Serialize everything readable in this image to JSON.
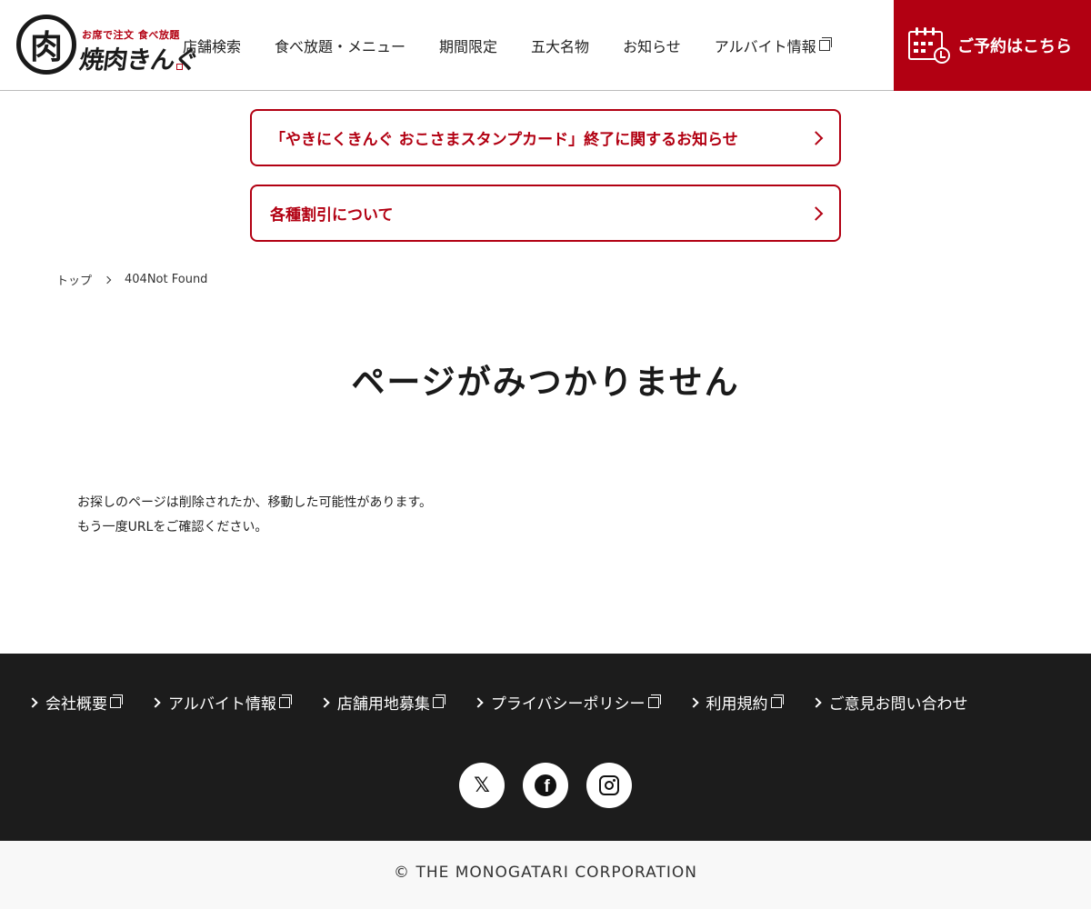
{
  "header": {
    "logo": {
      "mark": "肉",
      "tagline": "お席で注文 食べ放題",
      "name": "焼肉きんぐ"
    },
    "nav": [
      {
        "label": "店舗検索",
        "external": false
      },
      {
        "label": "食べ放題・メニュー",
        "external": false
      },
      {
        "label": "期間限定",
        "external": false
      },
      {
        "label": "五大名物",
        "external": false
      },
      {
        "label": "お知らせ",
        "external": false
      },
      {
        "label": "アルバイト情報",
        "external": true
      }
    ],
    "reserve_label": "ご予約はこちら"
  },
  "notices": [
    {
      "label": "「やきにくきんぐ おこさまスタンプカード」終了に関するお知らせ"
    },
    {
      "label": "各種割引について"
    }
  ],
  "breadcrumb": {
    "home": "トップ",
    "current": "404Not Found"
  },
  "main": {
    "title": "ページがみつかりません",
    "message_line1": "お探しのページは削除されたか、移動した可能性があります。",
    "message_line2": "もう一度URLをご確認ください。"
  },
  "footer": {
    "links": [
      {
        "label": "会社概要",
        "external": true
      },
      {
        "label": "アルバイト情報",
        "external": true
      },
      {
        "label": "店舗用地募集",
        "external": true
      },
      {
        "label": "プライバシーポリシー",
        "external": true
      },
      {
        "label": "利用規約",
        "external": true
      },
      {
        "label": "ご意見お問い合わせ",
        "external": false
      }
    ],
    "social": [
      {
        "icon": "x-icon",
        "glyph": "𝕏"
      },
      {
        "icon": "facebook-icon",
        "glyph": "f"
      },
      {
        "icon": "instagram-icon",
        "glyph": ""
      }
    ],
    "copyright": "© THE MONOGATARI CORPORATION"
  },
  "colors": {
    "brand_red": "#b20012",
    "footer_bg": "#1c1c1c",
    "copyright_bg": "#f8f8f8"
  }
}
